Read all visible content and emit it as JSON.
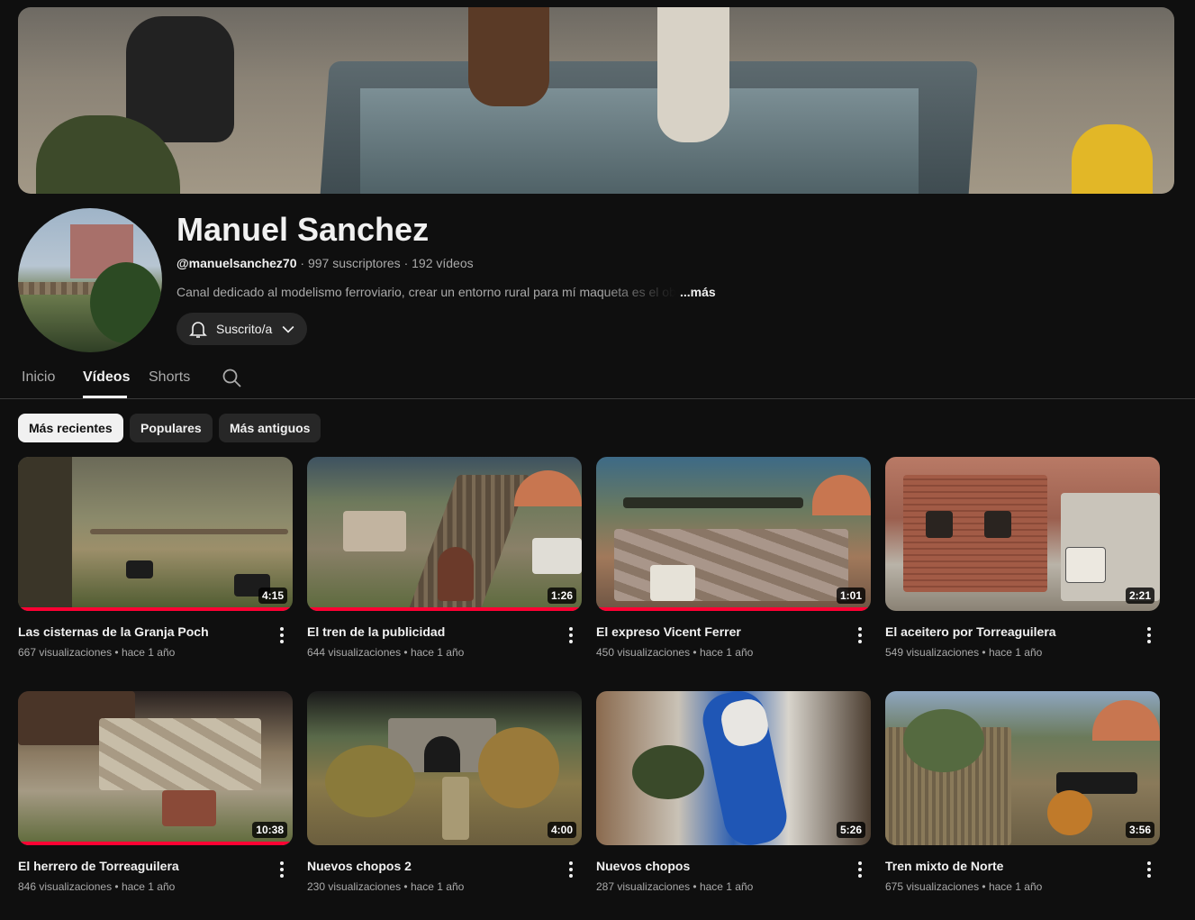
{
  "channel": {
    "name": "Manuel Sanchez",
    "handle": "@manuelsanchez70",
    "subscribers": "997 suscriptores",
    "videos_count": "192 vídeos",
    "separator": "·",
    "description": "Canal dedicado al modelismo ferroviario, crear un entorno rural para mí maqueta es el objetivo",
    "more_label": "...más",
    "subscribe_label": "Suscrito/a"
  },
  "tabs": [
    {
      "label": "Inicio",
      "active": false
    },
    {
      "label": "Vídeos",
      "active": true
    },
    {
      "label": "Shorts",
      "active": false
    }
  ],
  "chips": [
    {
      "label": "Más recientes",
      "active": true
    },
    {
      "label": "Populares",
      "active": false
    },
    {
      "label": "Más antiguos",
      "active": false
    }
  ],
  "videos": [
    {
      "title": "Las cisternas de la Granja Poch",
      "views": "667 visualizaciones",
      "age": "hace 1 año",
      "duration": "4:15",
      "watched": 1.0
    },
    {
      "title": "El tren de la publicidad",
      "views": "644 visualizaciones",
      "age": "hace 1 año",
      "duration": "1:26",
      "watched": 1.0
    },
    {
      "title": "El expreso Vicent Ferrer",
      "views": "450 visualizaciones",
      "age": "hace 1 año",
      "duration": "1:01",
      "watched": 1.0
    },
    {
      "title": "El aceitero por Torreaguilera",
      "views": "549 visualizaciones",
      "age": "hace 1 año",
      "duration": "2:21",
      "watched": 0.0
    },
    {
      "title": "El herrero de Torreaguilera",
      "views": "846 visualizaciones",
      "age": "hace 1 año",
      "duration": "10:38",
      "watched": 1.0
    },
    {
      "title": "Nuevos chopos 2",
      "views": "230 visualizaciones",
      "age": "hace 1 año",
      "duration": "4:00",
      "watched": 0.0
    },
    {
      "title": "Nuevos chopos",
      "views": "287 visualizaciones",
      "age": "hace 1 año",
      "duration": "5:26",
      "watched": 0.0
    },
    {
      "title": "Tren mixto de Norte",
      "views": "675 visualizaciones",
      "age": "hace 1 año",
      "duration": "3:56",
      "watched": 0.0
    }
  ],
  "colors": {
    "background": "#0f0f0f",
    "progress": "#ff0033",
    "chip_bg": "#272727",
    "chip_active_bg": "#f1f1f1"
  },
  "icons": {
    "bell": "bell-icon",
    "chevron": "chevron-down-icon",
    "search": "search-icon",
    "menu": "more-vert-icon"
  }
}
